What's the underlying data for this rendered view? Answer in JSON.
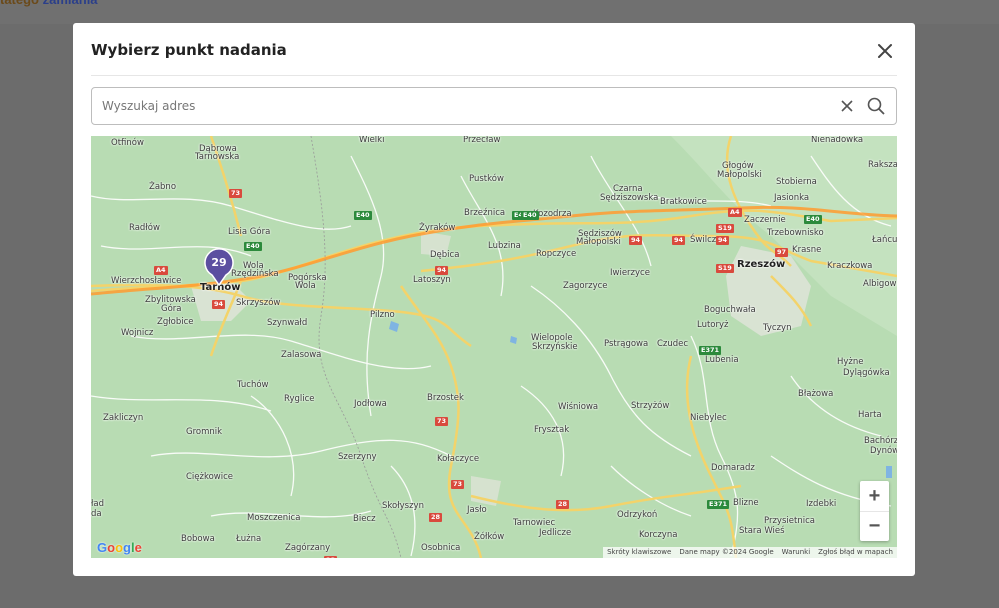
{
  "page": {
    "topbar_text_orange": "tatego ",
    "topbar_text_blue": "zamiania"
  },
  "modal": {
    "title": "Wybierz punkt nadania"
  },
  "search": {
    "placeholder": "Wyszukaj adres",
    "value": ""
  },
  "map": {
    "places": [
      {
        "name": "Otfinów",
        "big": false
      },
      {
        "name": "Dąbrowa",
        "big": false
      },
      {
        "name": "Tarnowska",
        "big": false
      },
      {
        "name": "Żabno",
        "big": false
      },
      {
        "name": "Radłów",
        "big": false
      },
      {
        "name": "Lisia Góra",
        "big": false
      },
      {
        "name": "Wierzchosławice",
        "big": false
      },
      {
        "name": "Wola",
        "big": false
      },
      {
        "name": "Rzędzińska",
        "big": false
      },
      {
        "name": "Pogórska",
        "big": false
      },
      {
        "name": "Wola",
        "big": false
      },
      {
        "name": "Tarnów",
        "big": true
      },
      {
        "name": "Zbylitowska",
        "big": false
      },
      {
        "name": "Góra",
        "big": false
      },
      {
        "name": "Skrzyszów",
        "big": false
      },
      {
        "name": "Zgłobice",
        "big": false
      },
      {
        "name": "Wojnicz",
        "big": false
      },
      {
        "name": "Szynwałd",
        "big": false
      },
      {
        "name": "Zalasowa",
        "big": false
      },
      {
        "name": "Tuchów",
        "big": false
      },
      {
        "name": "Ryglice",
        "big": false
      },
      {
        "name": "Zakliczyn",
        "big": false
      },
      {
        "name": "Gromnik",
        "big": false
      },
      {
        "name": "Ciężkowice",
        "big": false
      },
      {
        "name": "Moszczenica",
        "big": false
      },
      {
        "name": "Bobowa",
        "big": false
      },
      {
        "name": "Łużna",
        "big": false
      },
      {
        "name": "Zagórzany",
        "big": false
      },
      {
        "name": "Wielki",
        "big": false
      },
      {
        "name": "Przecław",
        "big": false
      },
      {
        "name": "Pustków",
        "big": false
      },
      {
        "name": "Brzeźnica",
        "big": false
      },
      {
        "name": "Kozodrza",
        "big": false
      },
      {
        "name": "Żyraków",
        "big": false
      },
      {
        "name": "Dębica",
        "big": false
      },
      {
        "name": "Lubzina",
        "big": false
      },
      {
        "name": "Ropczyce",
        "big": false
      },
      {
        "name": "Latoszyn",
        "big": false
      },
      {
        "name": "Pilzno",
        "big": false
      },
      {
        "name": "Jodłowa",
        "big": false
      },
      {
        "name": "Brzostek",
        "big": false
      },
      {
        "name": "Szerzyny",
        "big": false
      },
      {
        "name": "Kołaczyce",
        "big": false
      },
      {
        "name": "Skołyszyn",
        "big": false
      },
      {
        "name": "Biecz",
        "big": false
      },
      {
        "name": "Jasło",
        "big": false
      },
      {
        "name": "Osobnica",
        "big": false
      },
      {
        "name": "Żółków",
        "big": false
      },
      {
        "name": "Tarnowiec",
        "big": false
      },
      {
        "name": "Jedlicze",
        "big": false
      },
      {
        "name": "Czarna",
        "big": false
      },
      {
        "name": "Sędziszowska",
        "big": false
      },
      {
        "name": "Bratkowice",
        "big": false
      },
      {
        "name": "Sędziszów",
        "big": false
      },
      {
        "name": "Małopolski",
        "big": false
      },
      {
        "name": "Iwierzyce",
        "big": false
      },
      {
        "name": "Zagorzyce",
        "big": false
      },
      {
        "name": "Wielopole",
        "big": false
      },
      {
        "name": "Skrzyńskie",
        "big": false
      },
      {
        "name": "Pstrągowa",
        "big": false
      },
      {
        "name": "Czudec",
        "big": false
      },
      {
        "name": "Wiśniowa",
        "big": false
      },
      {
        "name": "Frysztak",
        "big": false
      },
      {
        "name": "Strzyżów",
        "big": false
      },
      {
        "name": "Odrzykoń",
        "big": false
      },
      {
        "name": "Korczyna",
        "big": false
      },
      {
        "name": "Niebylec",
        "big": false
      },
      {
        "name": "Domaradz",
        "big": false
      },
      {
        "name": "Blizne",
        "big": false
      },
      {
        "name": "Nienadówka",
        "big": false
      },
      {
        "name": "Głogów",
        "big": false
      },
      {
        "name": "Małopolski",
        "big": false
      },
      {
        "name": "Stobierna",
        "big": false
      },
      {
        "name": "Jasionka",
        "big": false
      },
      {
        "name": "Raksza",
        "big": false
      },
      {
        "name": "Zaczernie",
        "big": false
      },
      {
        "name": "Trzebownisko",
        "big": false
      },
      {
        "name": "Świlcza",
        "big": false
      },
      {
        "name": "Krasne",
        "big": false
      },
      {
        "name": "Łańcut",
        "big": false
      },
      {
        "name": "Rzeszów",
        "big": true
      },
      {
        "name": "Kraczkowa",
        "big": false
      },
      {
        "name": "Albigowa",
        "big": false
      },
      {
        "name": "Boguchwała",
        "big": false
      },
      {
        "name": "Lutoryż",
        "big": false
      },
      {
        "name": "Tyczyn",
        "big": false
      },
      {
        "name": "Lubenia",
        "big": false
      },
      {
        "name": "Hyżne",
        "big": false
      },
      {
        "name": "Dylągówka",
        "big": false
      },
      {
        "name": "Błażowa",
        "big": false
      },
      {
        "name": "Harta",
        "big": false
      },
      {
        "name": "Bachórz",
        "big": false
      },
      {
        "name": "Dynów",
        "big": false
      },
      {
        "name": "Izdebki",
        "big": false
      },
      {
        "name": "Przysietnica",
        "big": false
      },
      {
        "name": "Stara Wieś",
        "big": false
      },
      {
        "name": "ład",
        "big": false
      },
      {
        "name": "da",
        "big": false
      }
    ],
    "road_shields": [
      "73",
      "E40",
      "E40",
      "A4",
      "94",
      "94",
      "94",
      "94",
      "94",
      "E40",
      "A4",
      "S19",
      "S19",
      "97",
      "E40",
      "E40",
      "E371",
      "73",
      "73",
      "28",
      "28",
      "28",
      "E371"
    ],
    "marker_count": "29",
    "zoom_in": "+",
    "zoom_out": "−",
    "google": [
      "G",
      "o",
      "o",
      "g",
      "l",
      "e"
    ],
    "attribution": [
      "Skróty klawiszowe",
      "Dane mapy ©2024 Google",
      "Warunki",
      "Zgłoś błąd w mapach"
    ]
  },
  "colors": {
    "map_bg": "#b8dcb3",
    "road_yellow": "#f3d36a",
    "marker": "#5b4fa0",
    "shield_red": "#d94a3d",
    "shield_green": "#2c8a3c"
  }
}
